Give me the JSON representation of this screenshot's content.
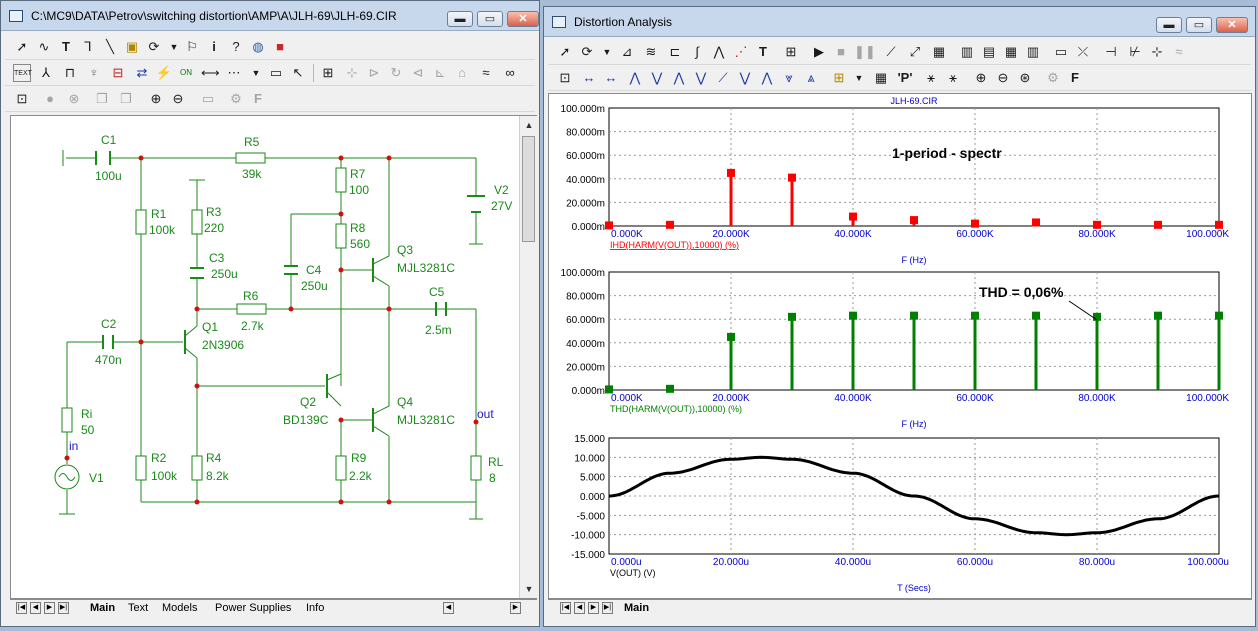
{
  "schematic_window": {
    "title": "C:\\MC9\\DATA\\Petrov\\switching distortion\\AMP\\A\\JLH-69\\JLH-69.CIR",
    "controls": {
      "minimize": "▬",
      "maximize": "▭",
      "close": "✕"
    },
    "components": [
      {
        "ref": "C1",
        "value": "100u"
      },
      {
        "ref": "R5",
        "value": "39k"
      },
      {
        "ref": "R7",
        "value": "100"
      },
      {
        "ref": "V2",
        "value": "27V"
      },
      {
        "ref": "R1",
        "value": "100k"
      },
      {
        "ref": "R3",
        "value": "220"
      },
      {
        "ref": "R8",
        "value": "560"
      },
      {
        "ref": "C3",
        "value": "250u"
      },
      {
        "ref": "C4",
        "value": "250u"
      },
      {
        "ref": "Q3",
        "value": "MJL3281C"
      },
      {
        "ref": "R6",
        "value": "2.7k"
      },
      {
        "ref": "C5",
        "value": "2.5m"
      },
      {
        "ref": "C2",
        "value": "470n"
      },
      {
        "ref": "Q1",
        "value": "2N3906"
      },
      {
        "ref": "Q2",
        "value": "BD139C"
      },
      {
        "ref": "Q4",
        "value": "MJL3281C"
      },
      {
        "ref": "Ri",
        "value": "50"
      },
      {
        "ref": "R2",
        "value": "100k"
      },
      {
        "ref": "R4",
        "value": "8.2k"
      },
      {
        "ref": "R9",
        "value": "2.2k"
      },
      {
        "ref": "RL",
        "value": "8"
      },
      {
        "ref": "V1",
        "value": ""
      }
    ],
    "node_labels": {
      "in": "in",
      "out": "out"
    },
    "tabs": [
      "Main",
      "Text",
      "Models",
      "Power Supplies",
      "Info"
    ]
  },
  "analysis_window": {
    "title": "Distortion Analysis",
    "controls": {
      "minimize": "▬",
      "maximize": "▭",
      "close": "✕"
    },
    "file_label": "JLH-69.CIR",
    "tabs": [
      "Main"
    ],
    "colors": {
      "ihd": "#ff0000",
      "thd": "#008000",
      "vout": "#000000",
      "axis_text": "#0000cc"
    }
  },
  "chart_data": [
    {
      "type": "bar",
      "title": "1-period - spectr",
      "file_label": "JLH-69.CIR",
      "xlabel": "F (Hz)",
      "ylabel": "IHD(HARM(V(OUT)),10000) (%)",
      "xlim": [
        0,
        100000
      ],
      "ylim": [
        0,
        0.1
      ],
      "grid": true,
      "xticks": [
        "0.000K",
        "20.000K",
        "40.000K",
        "60.000K",
        "80.000K",
        "100.000K"
      ],
      "yticks": [
        "0.000m",
        "20.000m",
        "40.000m",
        "60.000m",
        "80.000m",
        "100.000m"
      ],
      "x": [
        0,
        10000,
        20000,
        30000,
        40000,
        50000,
        60000,
        70000,
        80000,
        90000,
        100000
      ],
      "values": [
        0.0005,
        0.001,
        0.045,
        0.041,
        0.008,
        0.005,
        0.002,
        0.003,
        0.001,
        0.001,
        0.001
      ]
    },
    {
      "type": "bar",
      "xlabel": "F (Hz)",
      "ylabel": "THD(HARM(V(OUT)),10000) (%)",
      "annotation": "THD = 0,06%",
      "xlim": [
        0,
        100000
      ],
      "ylim": [
        0,
        0.1
      ],
      "grid": true,
      "xticks": [
        "0.000K",
        "20.000K",
        "40.000K",
        "60.000K",
        "80.000K",
        "100.000K"
      ],
      "yticks": [
        "0.000m",
        "20.000m",
        "40.000m",
        "60.000m",
        "80.000m",
        "100.000m"
      ],
      "x": [
        0,
        10000,
        20000,
        30000,
        40000,
        50000,
        60000,
        70000,
        80000,
        90000,
        100000
      ],
      "values": [
        0.0005,
        0.001,
        0.045,
        0.062,
        0.063,
        0.063,
        0.063,
        0.063,
        0.062,
        0.063,
        0.063
      ]
    },
    {
      "type": "line",
      "xlabel": "T (Secs)",
      "ylabel": "V(OUT) (V)",
      "xlim": [
        0,
        0.0001
      ],
      "ylim": [
        -15,
        15
      ],
      "grid": true,
      "xticks": [
        "0.000u",
        "20.000u",
        "40.000u",
        "60.000u",
        "80.000u",
        "100.000u"
      ],
      "yticks": [
        "-15.000",
        "-10.000",
        "-5.000",
        "0.000",
        "5.000",
        "10.000",
        "15.000"
      ],
      "x": [
        0,
        1e-05,
        2e-05,
        2.5e-05,
        3e-05,
        4e-05,
        5e-05,
        6e-05,
        7e-05,
        7.5e-05,
        8e-05,
        9e-05,
        0.0001
      ],
      "y": [
        0,
        5.9,
        9.5,
        10,
        9.5,
        5.9,
        0,
        -5.9,
        -9.5,
        -10,
        -9.5,
        -5.9,
        0
      ]
    }
  ]
}
